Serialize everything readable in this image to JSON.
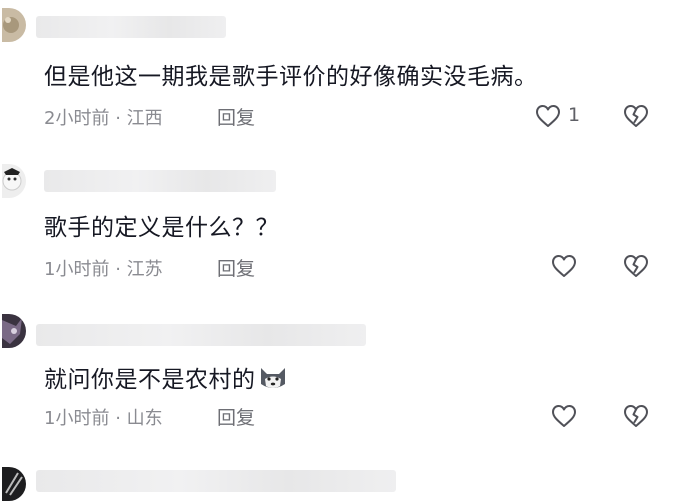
{
  "comments": [
    {
      "content": "但是他这一期我是歌手评价的好像确实没毛病。",
      "time": "2小时前",
      "separator": "·",
      "location": "江西",
      "reply_label": "回复",
      "like_count": "1",
      "like_icon": "heart-outline-icon",
      "dislike_icon": "broken-heart-icon"
    },
    {
      "content": "歌手的定义是什么？？",
      "time": "1小时前",
      "separator": "·",
      "location": "江苏",
      "reply_label": "回复",
      "like_icon": "heart-outline-icon",
      "dislike_icon": "broken-heart-icon"
    },
    {
      "content": "就问你是不是农村的",
      "content_emoji": "husky-dog-emoji",
      "time": "1小时前",
      "separator": "·",
      "location": "山东",
      "reply_label": "回复",
      "like_icon": "heart-outline-icon",
      "dislike_icon": "broken-heart-icon"
    }
  ],
  "colors": {
    "text": "#161823",
    "meta": "#8a8b91",
    "icon": "#6e6f75",
    "background": "#ffffff"
  }
}
